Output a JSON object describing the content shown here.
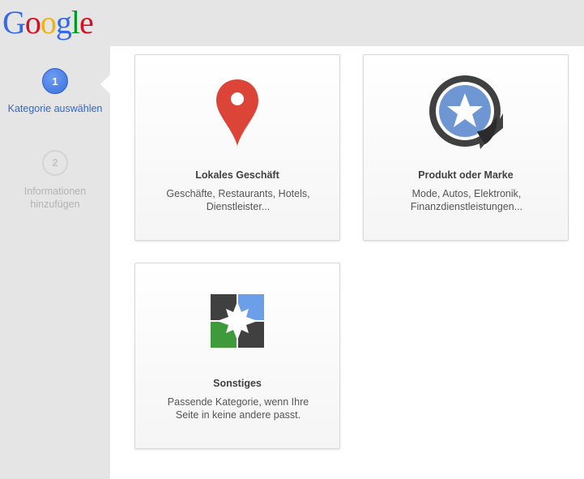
{
  "logo": {
    "letters": [
      "G",
      "o",
      "o",
      "g",
      "l",
      "e"
    ],
    "colors": [
      "#3369e8",
      "#d50f25",
      "#eeb211",
      "#3369e8",
      "#009925",
      "#d50f25"
    ]
  },
  "steps": [
    {
      "number": "1",
      "label_line1": "Kategorie auswählen",
      "label_line2": "",
      "state": "active"
    },
    {
      "number": "2",
      "label_line1": "Informationen",
      "label_line2": "hinzufügen",
      "state": "inactive"
    }
  ],
  "categories": [
    {
      "icon": "map-pin-icon",
      "title": "Lokales Geschäft",
      "desc_line1": "Geschäfte, Restaurants, Hotels,",
      "desc_line2": "Dienstleister..."
    },
    {
      "icon": "star-badge-icon",
      "title": "Produkt oder Marke",
      "desc_line1": "Mode, Autos, Elektronik,",
      "desc_line2": "Finanzdienstleistungen..."
    },
    {
      "icon": "puzzle-squares-icon",
      "title": "Sonstiges",
      "desc_line1": "Passende Kategorie, wenn Ihre",
      "desc_line2": "Seite in keine andere passt."
    }
  ],
  "colors": {
    "accent_blue": "#3366cc",
    "pin_red": "#db4437",
    "badge_dark": "#404040",
    "badge_blue": "#6d96d3",
    "tile_green": "#3e9a3a",
    "tile_blue": "#6d9ee8",
    "tile_dark": "#404040"
  }
}
